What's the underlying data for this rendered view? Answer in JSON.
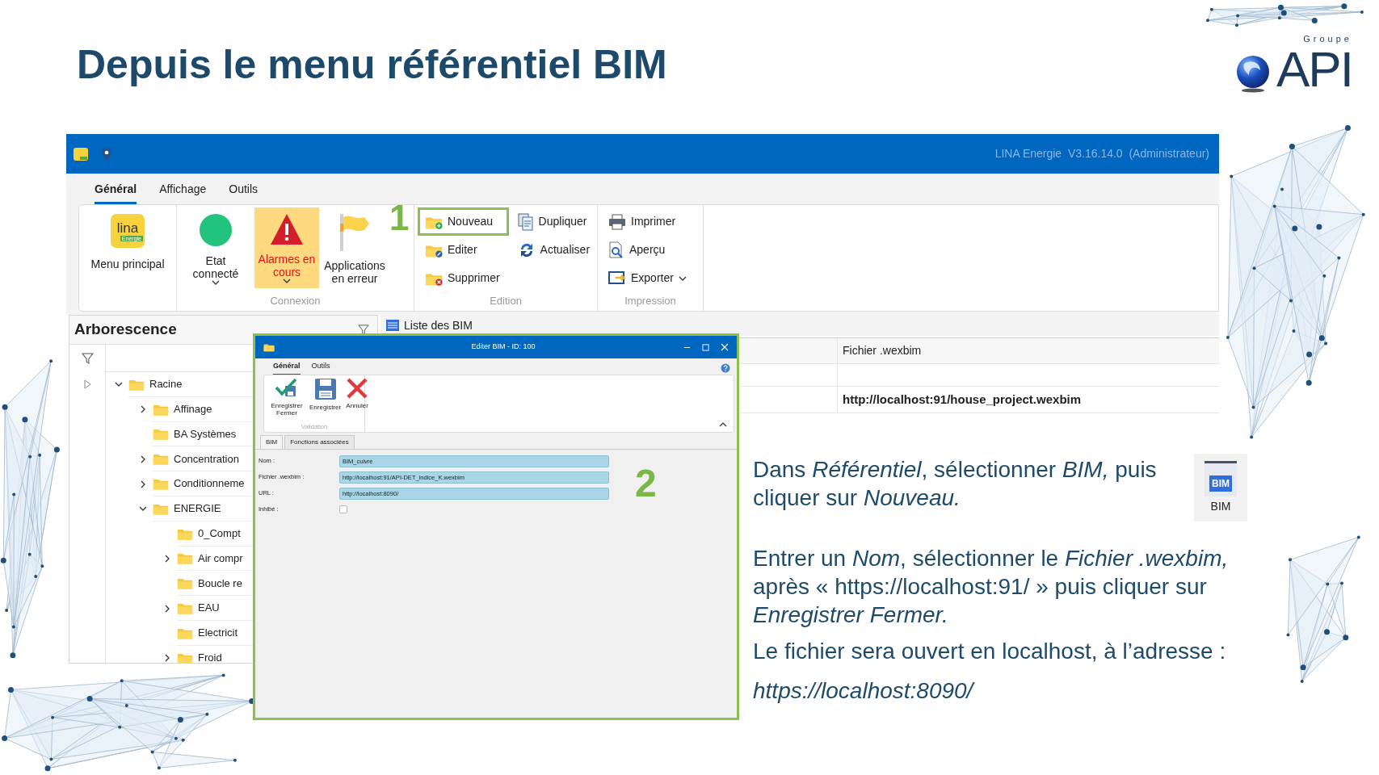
{
  "slide": {
    "title": "Depuis le menu référentiel BIM"
  },
  "logo": {
    "small": "Groupe",
    "name": "API"
  },
  "app": {
    "title": "LINA Energie  V3.16.14.0  (Administrateur)",
    "ribbon_tabs": [
      {
        "label": "Général",
        "selected": true
      },
      {
        "label": "Affichage",
        "selected": false
      },
      {
        "label": "Outils",
        "selected": false
      }
    ],
    "menu_button": {
      "label": "Menu principal",
      "logo_text": "lina",
      "logo_tag": "Energie"
    },
    "groups": [
      {
        "label": "Connexion",
        "kind": "large",
        "buttons": [
          {
            "kind": "status",
            "label": "Etat connecté",
            "connected": true,
            "dropdown": true,
            "highlighted": false
          },
          {
            "kind": "alarm",
            "label": "Alarmes en cours",
            "dropdown": true,
            "highlighted": true
          },
          {
            "kind": "flag",
            "label": "Applications en erreur",
            "dropdown": false,
            "highlighted": false
          }
        ]
      },
      {
        "label": "Edition",
        "kind": "small",
        "buttons": [
          {
            "kind": "new",
            "label": "Nouveau",
            "outlined": true,
            "annotation": "1"
          },
          {
            "kind": "copy",
            "label": "Dupliquer",
            "outlined": false
          },
          {
            "kind": "edit",
            "label": "Editer",
            "outlined": false
          },
          {
            "kind": "refresh",
            "label": "Actualiser",
            "outlined": false
          },
          {
            "kind": "delete",
            "label": "Supprimer",
            "outlined": false
          }
        ]
      },
      {
        "label": "Impression",
        "kind": "small",
        "buttons": [
          {
            "kind": "print",
            "label": "Imprimer",
            "outlined": false
          },
          {
            "kind": "preview",
            "label": "Aperçu",
            "outlined": false
          },
          {
            "kind": "export",
            "label": "Exporter",
            "outlined": false,
            "dropdown": true
          }
        ]
      }
    ],
    "tree": {
      "title": "Arborescence",
      "items": [
        {
          "label": "Racine",
          "expanded": true,
          "current": true,
          "children": [
            {
              "label": "Affinage",
              "expanded": false
            },
            {
              "label": "BA Systèmes"
            },
            {
              "label": "Concentration",
              "expanded": false
            },
            {
              "label": "Conditionneme",
              "expanded": false
            },
            {
              "label": "ENERGIE",
              "expanded": true,
              "children": [
                {
                  "label": "0_Compt"
                },
                {
                  "label": "Air compr",
                  "expanded": false
                },
                {
                  "label": "Boucle re"
                },
                {
                  "label": "EAU",
                  "expanded": false
                },
                {
                  "label": "Electricit"
                },
                {
                  "label": "Froid",
                  "expanded": false
                }
              ]
            }
          ]
        }
      ]
    },
    "list": {
      "tab": "Liste des BIM",
      "column": "Fichier .wexbim",
      "rows": [
        {
          "kind": "blank"
        },
        {
          "kind": "data",
          "file": "http://localhost:91/house_project.wexbim"
        }
      ]
    }
  },
  "dialog": {
    "title": "Editer BIM - ID: 100",
    "ribbon_tabs": [
      {
        "label": "Général",
        "selected": true
      },
      {
        "label": "Outils",
        "selected": false
      }
    ],
    "buttons": [
      {
        "kind": "save_close",
        "label": "Enregistrer Fermer"
      },
      {
        "kind": "save",
        "label": "Enregistrer"
      },
      {
        "kind": "cancel",
        "label": "Annuler"
      }
    ],
    "group_label": "Validation",
    "tabs": [
      {
        "label": "BIM",
        "selected": true
      },
      {
        "label": "Fonctions associées",
        "selected": false
      }
    ],
    "fields": [
      {
        "kind": "text",
        "label": "Nom :",
        "value": "BIM_cuivre"
      },
      {
        "kind": "text",
        "label": "Fichier .wexbim :",
        "value": "http://localhost:91/API-DET_indice_K.wexbim"
      },
      {
        "kind": "text",
        "label": "URL :",
        "value": "http://localhost:8090/"
      },
      {
        "kind": "checkbox",
        "label": "Inhibé :",
        "checked": false
      }
    ],
    "annotation": "2"
  },
  "instructions": [
    {
      "kind": "text",
      "text": "Dans *Référentiel*, sélectionner *BIM,* puis cliquer sur *Nouveau.*"
    },
    {
      "kind": "text",
      "text": "Entrer un *Nom*, sélectionner le *Fichier .wexbim,* après « https://localhost:91/ » puis cliquer sur *Enregistrer Fermer.*"
    },
    {
      "kind": "text",
      "text": "Le fichier sera ouvert en localhost, à l’adresse :"
    },
    {
      "kind": "emphasis",
      "text": "https://localhost:8090/"
    }
  ],
  "bim_icon": {
    "badge": "BIM",
    "caption": "BIM"
  }
}
